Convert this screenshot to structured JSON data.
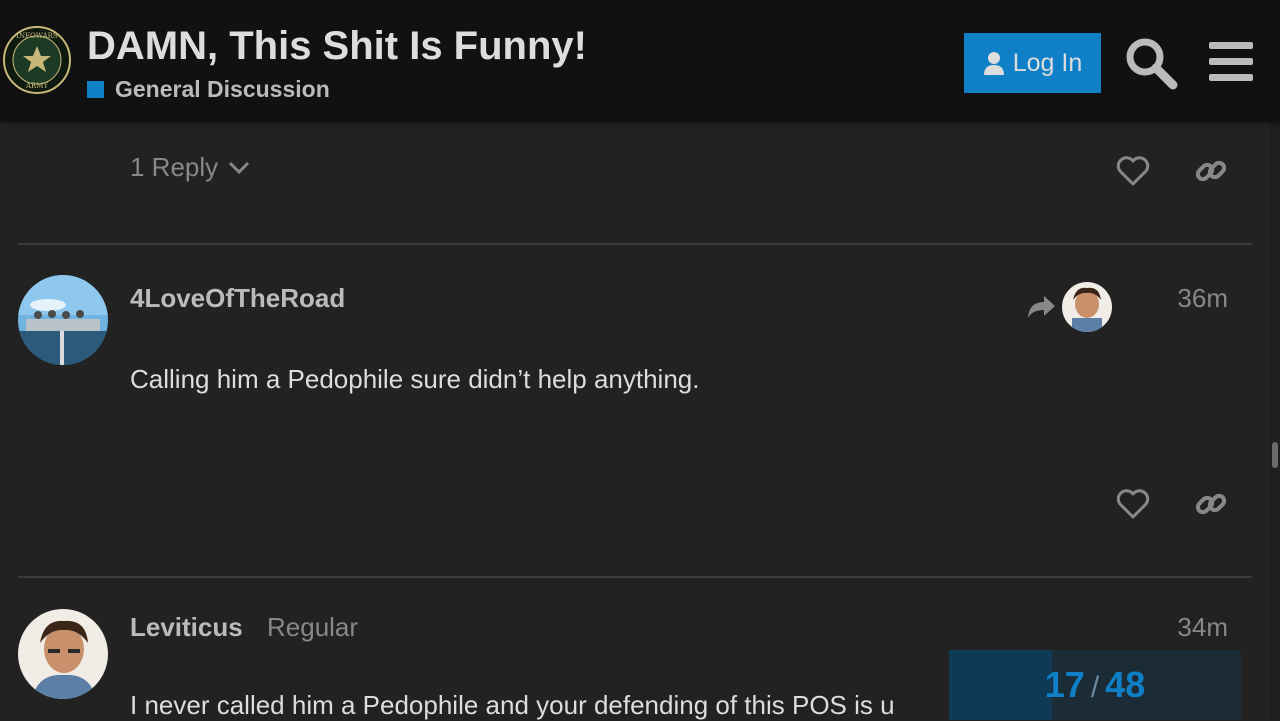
{
  "header": {
    "title": "DAMN, This Shit Is Funny!",
    "category": {
      "name": "General Discussion",
      "color": "#0f7fc7"
    },
    "login_label": "Log In",
    "logo_icon": "infowars-army-seal"
  },
  "previous_post": {
    "reply_count_label": "1 Reply"
  },
  "posts": [
    {
      "username": "4LoveOfTheRoad",
      "user_title": "",
      "time": "36m",
      "body": "Calling him a Pedophile sure didn’t help anything.",
      "reply_to_icon": "share-arrow-icon"
    },
    {
      "username": "Leviticus",
      "user_title": "Regular",
      "time": "34m",
      "body": "I never called him a Pedophile and your defending of this POS is u"
    }
  ],
  "progress": {
    "current": "17",
    "separator": "/",
    "total": "48",
    "fraction": 0.354
  },
  "colors": {
    "background": "#222222",
    "header": "#111111",
    "accent": "#0f7fc7"
  }
}
